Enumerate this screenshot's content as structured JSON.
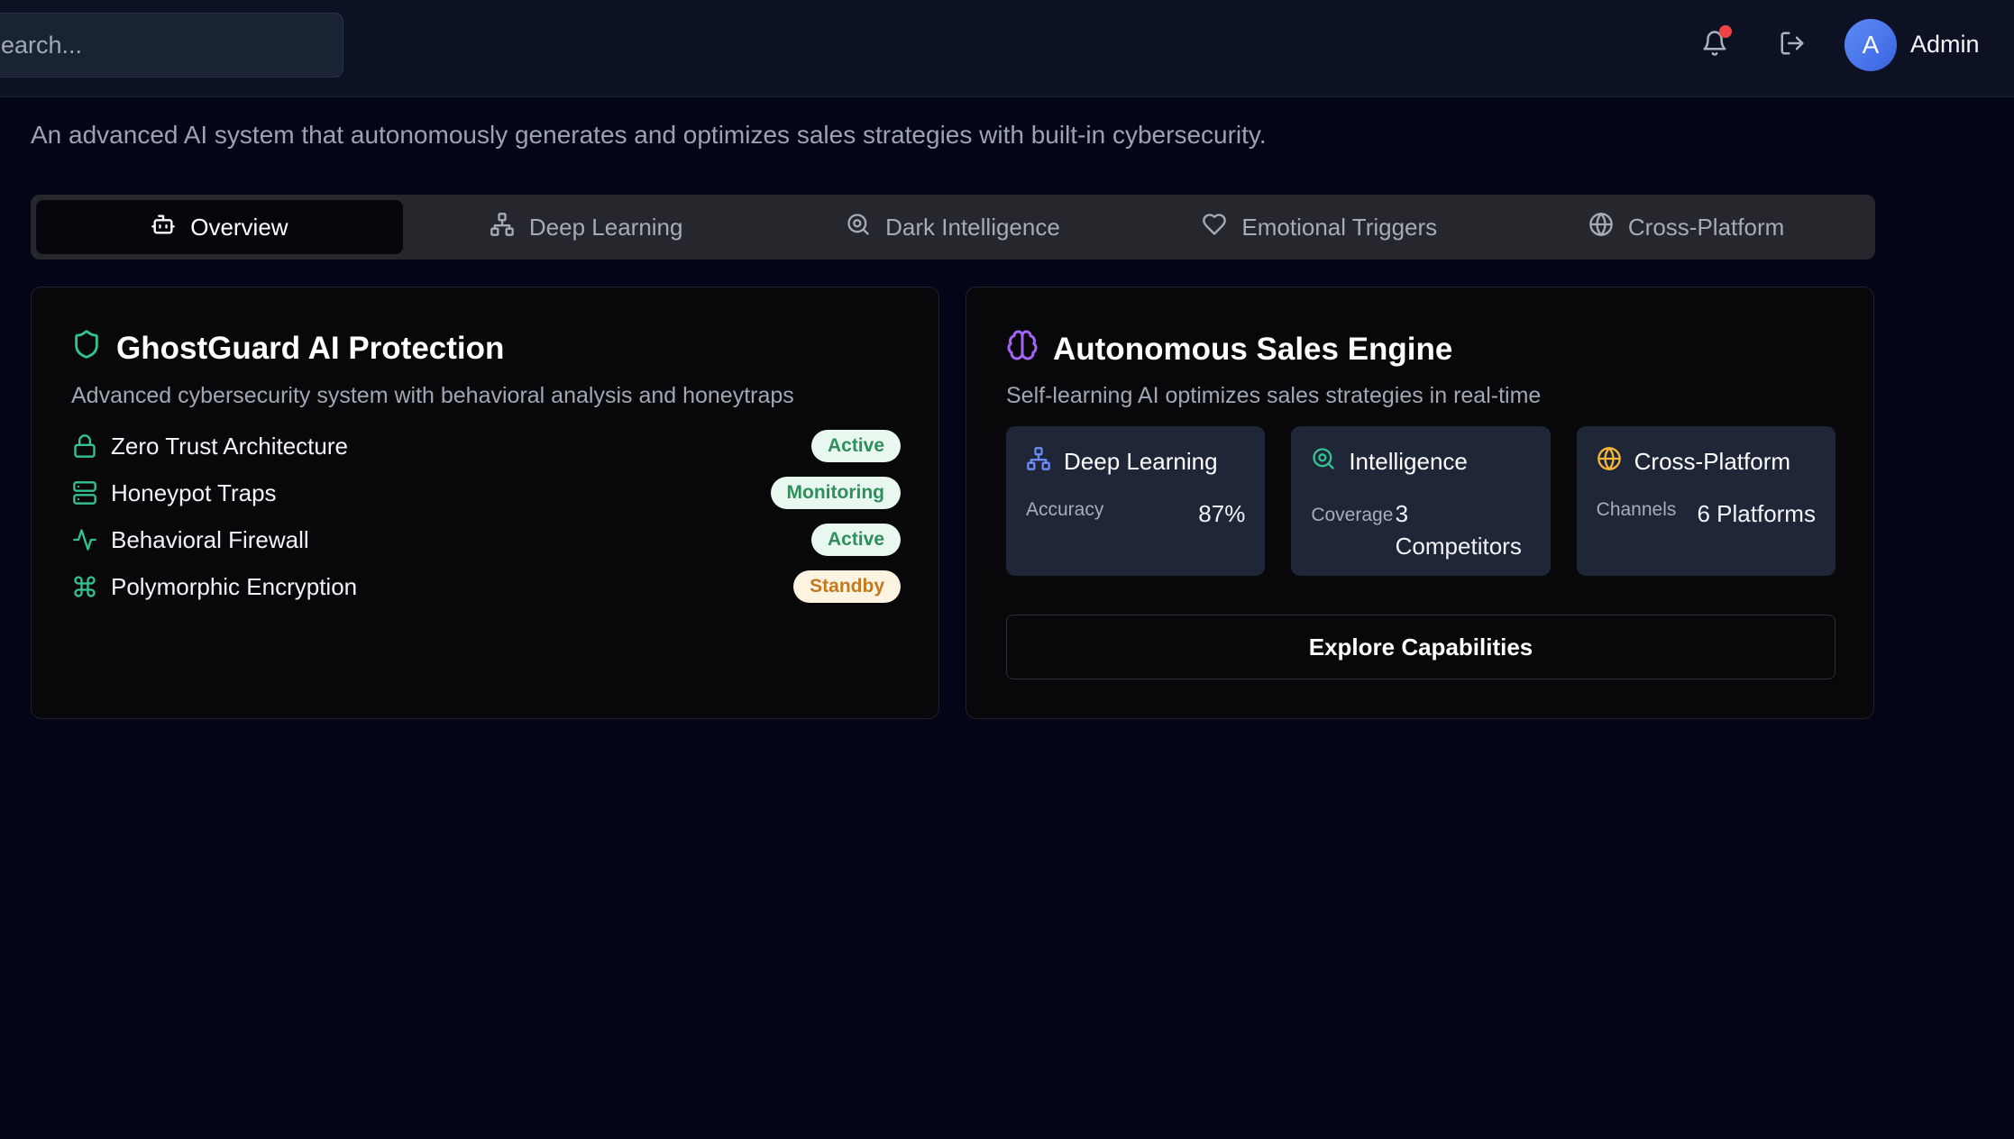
{
  "header": {
    "search_placeholder": "earch...",
    "avatar_initial": "A",
    "user_name": "Admin",
    "notification_dot_color": "#ef4444"
  },
  "hero": {
    "title": "",
    "subtitle": "An advanced AI system that autonomously generates and optimizes sales strategies with built-in cybersecurity."
  },
  "tabs": [
    {
      "label": "Overview",
      "icon": "robot-icon",
      "active": true
    },
    {
      "label": "Deep Learning",
      "icon": "network-icon",
      "active": false
    },
    {
      "label": "Dark Intelligence",
      "icon": "search-scan-icon",
      "active": false
    },
    {
      "label": "Emotional Triggers",
      "icon": "heart-icon",
      "active": false
    },
    {
      "label": "Cross-Platform",
      "icon": "globe-icon",
      "active": false
    }
  ],
  "protection": {
    "title": "GhostGuard AI Protection",
    "description": "Advanced cybersecurity system with behavioral analysis and honeytraps",
    "features": [
      {
        "label": "Zero Trust Architecture",
        "status": "Active",
        "icon": "lock-icon",
        "status_color": "#2f8f5c"
      },
      {
        "label": "Honeypot Traps",
        "status": "Monitoring",
        "icon": "server-icon",
        "status_color": "#2f8f5c"
      },
      {
        "label": "Behavioral Firewall",
        "status": "Active",
        "icon": "activity-icon",
        "status_color": "#2f8f5c"
      },
      {
        "label": "Polymorphic Encryption",
        "status": "Standby",
        "icon": "command-icon",
        "status_color": "#c27a1f"
      }
    ]
  },
  "sales_engine": {
    "title": "Autonomous Sales Engine",
    "description": "Self-learning AI optimizes sales strategies in real-time",
    "stats": [
      {
        "title": "Deep Learning",
        "key": "Accuracy",
        "value": "87%",
        "icon": "network-icon",
        "color": "#6b8cf5"
      },
      {
        "title": "Intelligence",
        "key": "Coverage",
        "value": "3 Competitors",
        "icon": "search-scan-icon",
        "color": "#34c38f"
      },
      {
        "title": "Cross-Platform",
        "key": "Channels",
        "value": "6 Platforms",
        "icon": "globe-icon",
        "color": "#f5b63a"
      }
    ],
    "button_label": "Explore Capabilities"
  },
  "colors": {
    "background": "#040617",
    "header": "#0c1223",
    "accent_green": "#34c38f",
    "accent_purple": "#a365f5"
  }
}
